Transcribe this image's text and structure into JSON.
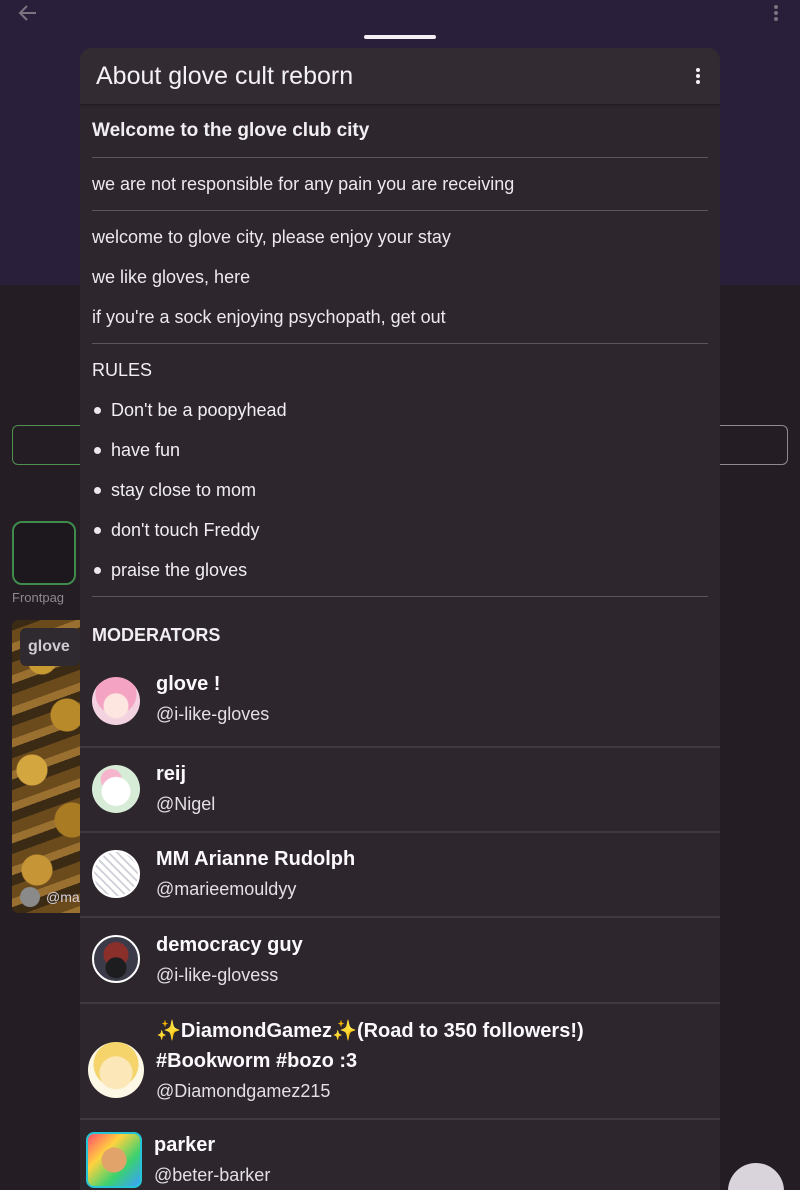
{
  "background": {
    "frontpage_label": "Frontpag",
    "card_tag": "glove",
    "card_user": "@ma"
  },
  "sheet": {
    "title": "About glove cult reborn",
    "welcome": "Welcome to the glove club city",
    "disclaimer": "we are not responsible for any pain you are receiving",
    "intro_lines": [
      "welcome to glove city, please enjoy your stay",
      "we like gloves, here",
      "if you're a sock enjoying psychopath, get out"
    ],
    "rules_title": "RULES",
    "rules": [
      "Don't be a poopyhead",
      "have fun",
      "stay close to mom",
      "don't touch Freddy",
      "praise the gloves"
    ],
    "moderators_title": "MODERATORS",
    "moderators": [
      {
        "name": "glove !",
        "handle": "@i-like-gloves"
      },
      {
        "name": "reij",
        "handle": "@Nigel"
      },
      {
        "name": "MM Arianne Rudolph",
        "handle": "@marieemouldyy"
      },
      {
        "name": "democracy guy",
        "handle": "@i-like-glovess"
      },
      {
        "name": "✨DiamondGamez✨(Road to 350 followers!) #Bookworm #bozo :3",
        "handle": "@Diamondgamez215"
      },
      {
        "name": "parker",
        "handle": "@beter-barker"
      }
    ]
  },
  "icons": {
    "back": "arrow-left-icon",
    "more": "more-vertical-icon",
    "fab": "add-icon"
  }
}
